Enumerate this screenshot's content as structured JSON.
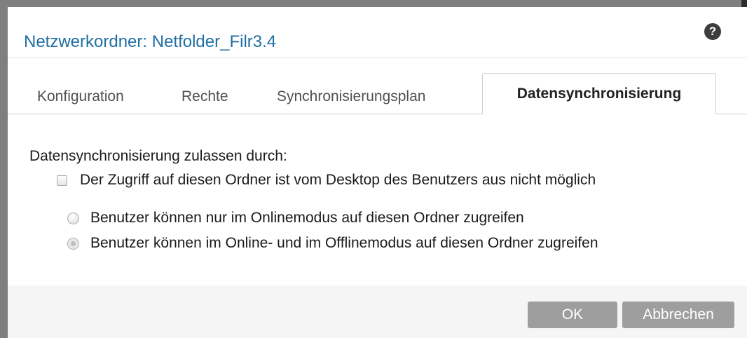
{
  "dialog": {
    "title": "Netzwerkordner: Netfolder_Filr3.4",
    "help_icon": "help-icon"
  },
  "tabs": [
    {
      "label": "Konfiguration",
      "active": false
    },
    {
      "label": "Rechte",
      "active": false
    },
    {
      "label": "Synchronisierungsplan",
      "active": false
    },
    {
      "label": "Datensynchronisierung",
      "active": true
    }
  ],
  "content": {
    "section_label": "Datensynchronisierung zulassen durch:",
    "checkbox": {
      "label": "Der Zugriff auf diesen Ordner ist vom Desktop des Benutzers aus nicht möglich",
      "checked": false
    },
    "radios": [
      {
        "label": "Benutzer können nur im Onlinemodus auf diesen Ordner zugreifen",
        "selected": false
      },
      {
        "label": "Benutzer können im Online- und im Offlinemodus auf diesen Ordner zugreifen",
        "selected": true
      }
    ]
  },
  "footer": {
    "ok_label": "OK",
    "cancel_label": "Abbrechen"
  }
}
